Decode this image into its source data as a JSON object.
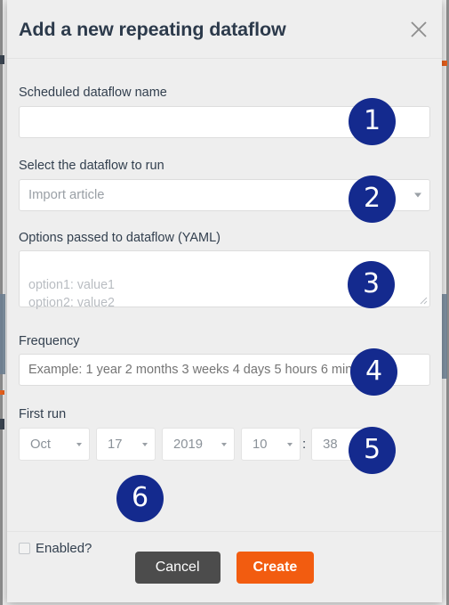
{
  "modal": {
    "title": "Add a new repeating dataflow",
    "close_icon": "close-icon"
  },
  "fields": {
    "name": {
      "label": "Scheduled dataflow name",
      "value": "",
      "placeholder": ""
    },
    "dataflow": {
      "label": "Select the dataflow to run",
      "selected": "Import article",
      "options": [
        "Import article"
      ]
    },
    "options_yaml": {
      "label": "Options passed to dataflow (YAML)",
      "value": "",
      "placeholder": "option1: value1\noption2: value2"
    },
    "frequency": {
      "label": "Frequency",
      "value": "",
      "placeholder": "Example: 1 year 2 months 3 weeks 4 days 5 hours 6 minute"
    },
    "first_run": {
      "label": "First run",
      "month": "Oct",
      "day": "17",
      "year": "2019",
      "hour": "10",
      "separator": ":",
      "minute": "38"
    },
    "enabled": {
      "label": "Enabled?",
      "checked": false
    }
  },
  "footer": {
    "cancel_label": "Cancel",
    "create_label": "Create"
  },
  "badges": [
    {
      "number": "1"
    },
    {
      "number": "2"
    },
    {
      "number": "3"
    },
    {
      "number": "4"
    },
    {
      "number": "5"
    },
    {
      "number": "6"
    }
  ],
  "colors": {
    "badge": "#142a8e",
    "create_button": "#f25c10",
    "cancel_button": "#4c4c4c",
    "modal_background": "#eeeeee",
    "label_text": "#33404f"
  }
}
